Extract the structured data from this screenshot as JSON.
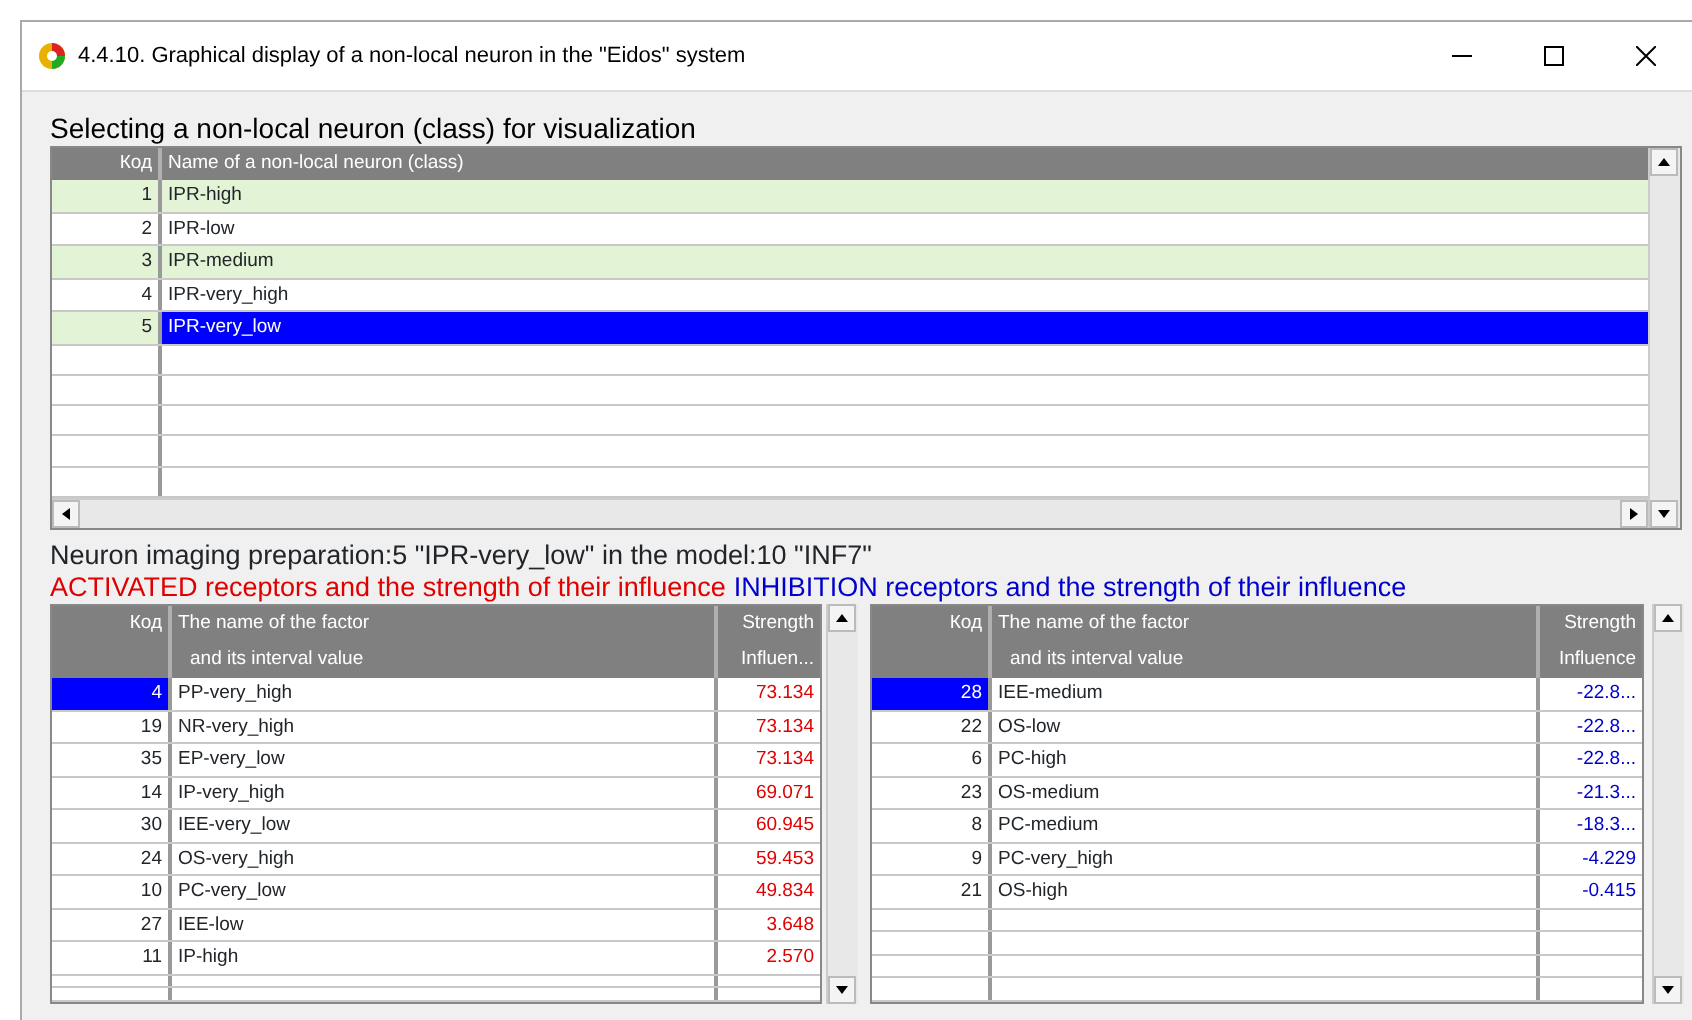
{
  "window": {
    "title": "4.4.10. Graphical display of a non-local neuron in the \"Eidos\" system"
  },
  "class_section": {
    "title": "Selecting a non-local neuron (class) for visualization",
    "columns": [
      "Код",
      "Name of a non-local neuron (class)"
    ],
    "rows": [
      {
        "code": "1",
        "name": "IPR-high",
        "selected": false
      },
      {
        "code": "2",
        "name": "IPR-low",
        "selected": false
      },
      {
        "code": "3",
        "name": "IPR-medium",
        "selected": false
      },
      {
        "code": "4",
        "name": "IPR-very_high",
        "selected": false
      },
      {
        "code": "5",
        "name": "IPR-very_low",
        "selected": true
      }
    ]
  },
  "preparation_label": "Neuron imaging preparation:5 \"IPR-very_low\" in the model:10 \"INF7\"",
  "receptor_tables": [
    {
      "kind": "activated",
      "title": "ACTIVATED receptors and the strength of their influence",
      "columns": [
        {
          "line_1": "Код"
        },
        {
          "line_1": "The name of the factor",
          "line_2": "and its interval value"
        },
        {
          "line_1": "Strength",
          "line_2": "Influen..."
        }
      ],
      "rows": [
        {
          "code": "4",
          "factor": "PP-very_high",
          "strength": "73.134",
          "selected": true
        },
        {
          "code": "19",
          "factor": "NR-very_high",
          "strength": "73.134",
          "selected": false
        },
        {
          "code": "35",
          "factor": "EP-very_low",
          "strength": "73.134",
          "selected": false
        },
        {
          "code": "14",
          "factor": "IP-very_high",
          "strength": "69.071",
          "selected": false
        },
        {
          "code": "30",
          "factor": "IEE-very_low",
          "strength": "60.945",
          "selected": false
        },
        {
          "code": "24",
          "factor": "OS-very_high",
          "strength": "59.453",
          "selected": false
        },
        {
          "code": "10",
          "factor": "PC-very_low",
          "strength": "49.834",
          "selected": false
        },
        {
          "code": "27",
          "factor": "IEE-low",
          "strength": "3.648",
          "selected": false
        },
        {
          "code": "11",
          "factor": "IP-high",
          "strength": "2.570",
          "selected": false
        }
      ]
    },
    {
      "kind": "inhibition",
      "title": "INHIBITION receptors and the strength of their influence",
      "columns": [
        {
          "line_1": "Код"
        },
        {
          "line_1": "The name of the factor",
          "line_2": "and its interval value"
        },
        {
          "line_1": "Strength",
          "line_2": "Influence"
        }
      ],
      "rows": [
        {
          "code": "28",
          "factor": "IEE-medium",
          "strength": "-22.8...",
          "selected": true
        },
        {
          "code": "22",
          "factor": "OS-low",
          "strength": "-22.8...",
          "selected": false
        },
        {
          "code": "6",
          "factor": "PC-high",
          "strength": "-22.8...",
          "selected": false
        },
        {
          "code": "23",
          "factor": "OS-medium",
          "strength": "-21.3...",
          "selected": false
        },
        {
          "code": "8",
          "factor": "PC-medium",
          "strength": "-18.3...",
          "selected": false
        },
        {
          "code": "9",
          "factor": "PC-very_high",
          "strength": "-4.229",
          "selected": false
        },
        {
          "code": "21",
          "factor": "OS-high",
          "strength": "-0.415",
          "selected": false
        }
      ]
    }
  ]
}
